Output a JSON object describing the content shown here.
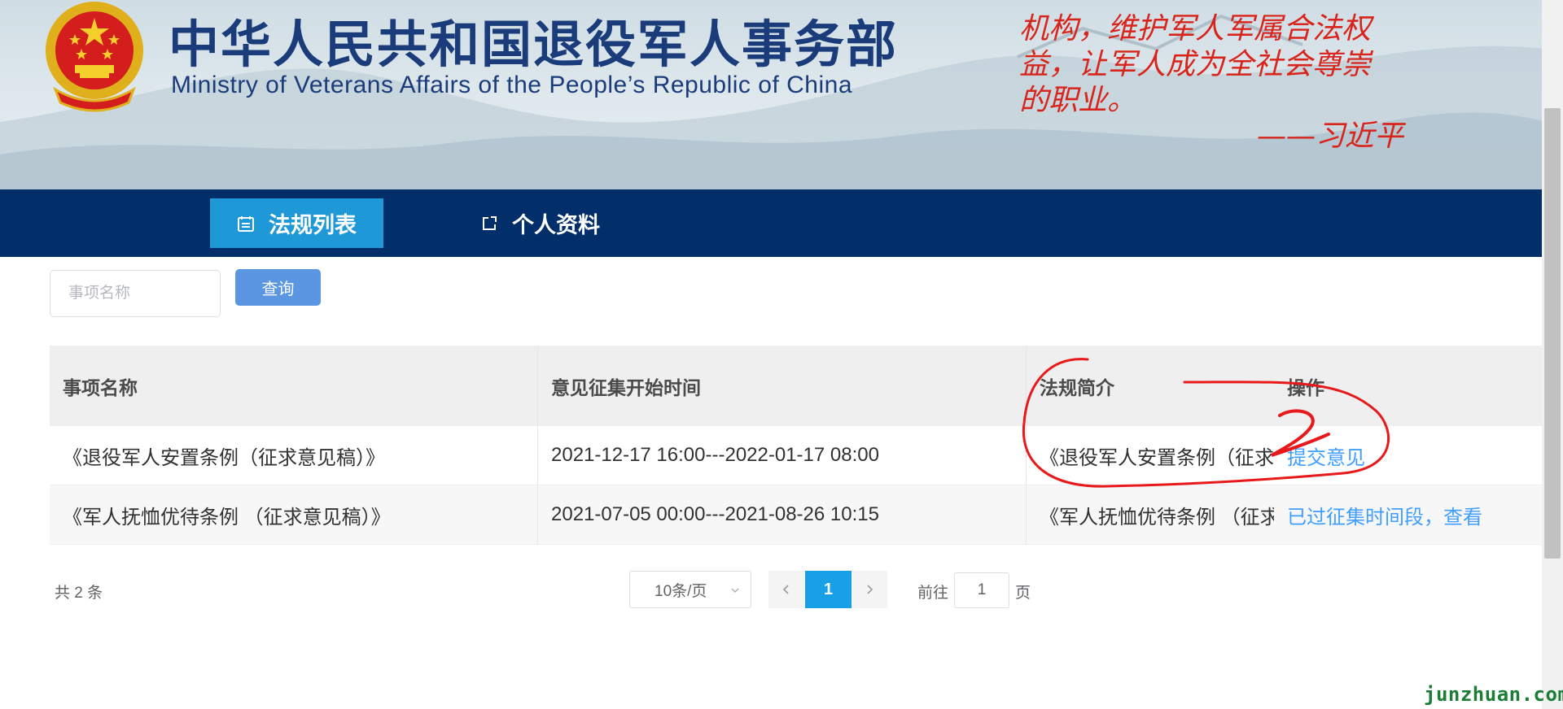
{
  "header": {
    "title_cn": "中华人民共和国退役军人事务部",
    "title_en": "Ministry of Veterans Affairs of the People’s Republic of China",
    "quote_lines": [
      "机构，维护军人军属合法权",
      "益，让军人成为全社会尊崇",
      "的职业。"
    ],
    "quote_author": "——习近平"
  },
  "nav": {
    "tabs": [
      {
        "label": "法规列表",
        "icon": "calendar-icon",
        "active": true
      },
      {
        "label": "个人资料",
        "icon": "external-link-icon",
        "active": false
      }
    ]
  },
  "search": {
    "placeholder": "事项名称",
    "value": "",
    "button_label": "查询"
  },
  "table": {
    "columns": [
      "事项名称",
      "意见征集开始时间",
      "法规简介",
      "操作"
    ],
    "rows": [
      {
        "name": "《退役军人安置条例（征求意见稿）》",
        "time": "2021-12-17 16:00---2022-01-17 08:00",
        "intro": "《退役军人安置条例（征求",
        "action": "提交意见"
      },
      {
        "name": "《军人抚恤优待条例 （征求意见稿）》",
        "time": "2021-07-05 00:00---2021-08-26 10:15",
        "intro": "《军人抚恤优待条例 （征求",
        "action": "已过征集时间段，查看"
      }
    ]
  },
  "pagination": {
    "total_text": "共 2 条",
    "page_size": "10条/页",
    "current_page": "1",
    "goto_label": "前往",
    "goto_value": "1",
    "goto_suffix": "页"
  },
  "annotation": {
    "number": "2",
    "color": "#e8191b"
  },
  "watermark": "junzhuan.com",
  "colors": {
    "nav_bg": "#022f6a",
    "active_tab": "#1e98d7",
    "primary_button": "#5a96e2",
    "link": "#409eff",
    "current_page": "#18a0e6",
    "title": "#1a3c7a",
    "quote": "#d9241b"
  }
}
